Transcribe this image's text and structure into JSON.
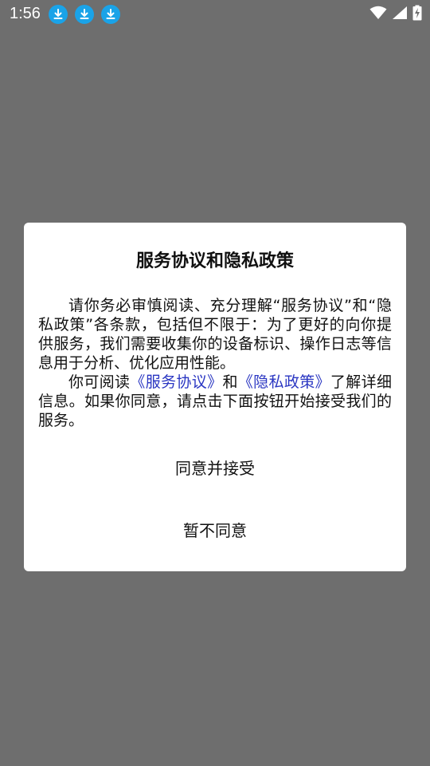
{
  "status_bar": {
    "time": "1:56",
    "notification_icons": [
      "download-icon",
      "download-icon",
      "download-icon"
    ],
    "system_icons": [
      "wifi-icon",
      "signal-icon",
      "battery-charging-icon"
    ]
  },
  "dialog": {
    "title": "服务协议和隐私政策",
    "paragraph1": "请你务必审慎阅读、充分理解“服务协议”和“隐私政策”各条款，包括但不限于：为了更好的向你提供服务，我们需要收集你的设备标识、操作日志等信息用于分析、优化应用性能。",
    "paragraph2": {
      "prefix": "你可阅读",
      "link1": "《服务协议》",
      "middle": "和",
      "link2": "《隐私政策》",
      "suffix": "了解详细信息。如果你同意，请点击下面按钮开始接受我们的服务。"
    },
    "agree_label": "同意并接受",
    "decline_label": "暂不同意"
  },
  "colors": {
    "overlay": "#6e6e6e",
    "link": "#2a36c2",
    "download_badge": "#1aa3e8"
  }
}
